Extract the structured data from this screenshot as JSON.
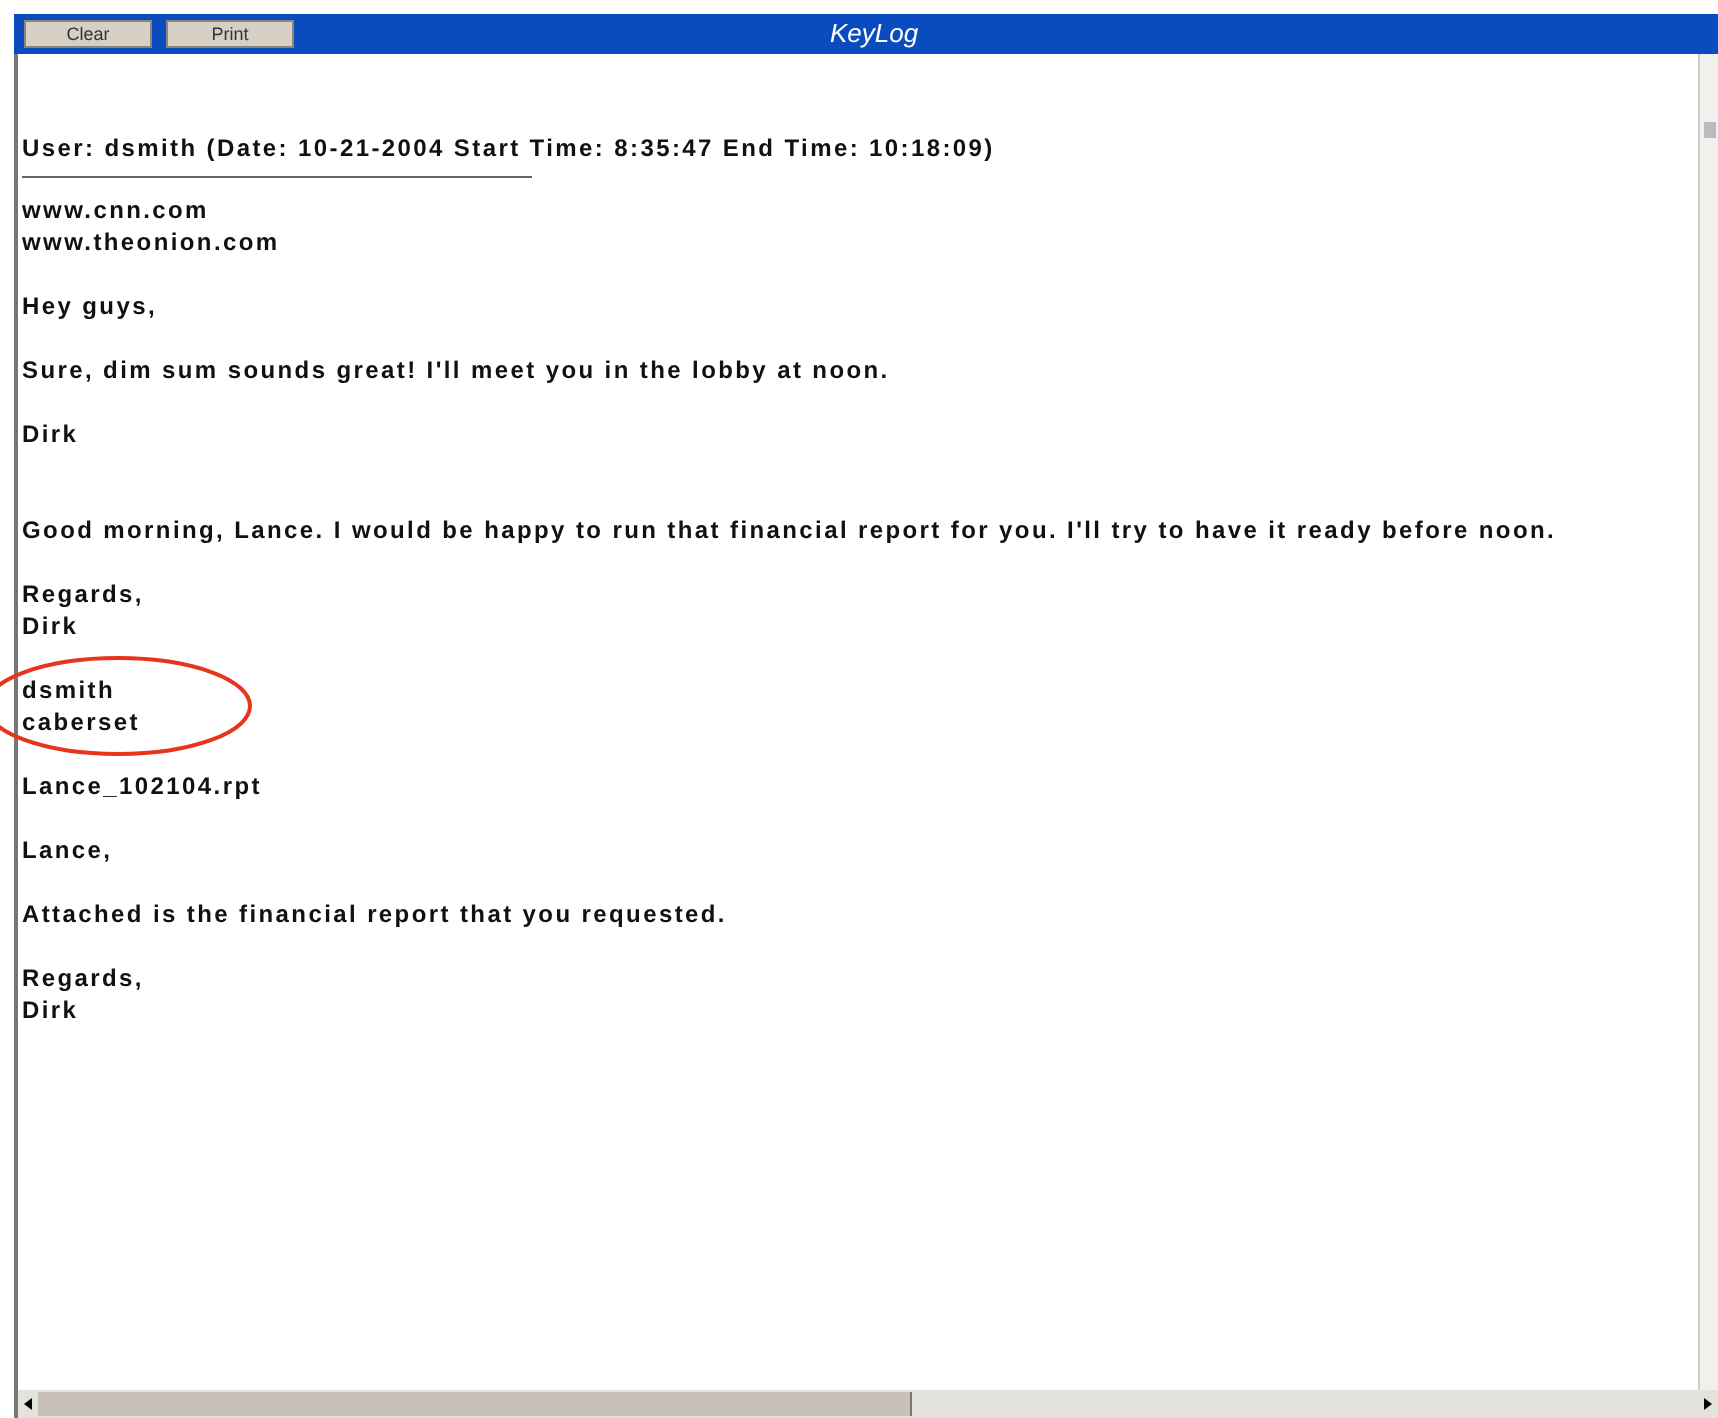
{
  "window": {
    "title": "KeyLog"
  },
  "toolbar": {
    "buttons": [
      "Clear",
      "Print"
    ]
  },
  "log": {
    "header": "User: dsmith  (Date: 10-21-2004  Start Time: 8:35:47  End Time: 10:18:09)",
    "blocks": [
      {
        "lines": [
          "www.cnn.com",
          "www.theonion.com"
        ],
        "break_before": false,
        "highlighted": false
      },
      {
        "lines": [
          "Hey guys,"
        ],
        "break_before": false,
        "highlighted": false
      },
      {
        "lines": [
          "Sure, dim sum sounds great!  I'll meet you in the lobby at noon."
        ],
        "break_before": false,
        "highlighted": false
      },
      {
        "lines": [
          "Dirk"
        ],
        "break_before": false,
        "highlighted": false
      },
      {
        "lines": [
          "Good morning, Lance.  I would be happy to run that financial report for you.  I'll try to have it ready before noon."
        ],
        "break_before": true,
        "highlighted": false
      },
      {
        "lines": [
          "Regards,",
          "Dirk"
        ],
        "break_before": false,
        "highlighted": false
      },
      {
        "lines": [
          "dsmith",
          "caberset"
        ],
        "break_before": false,
        "highlighted": true
      },
      {
        "lines": [
          "Lance_102104.rpt"
        ],
        "break_before": false,
        "highlighted": false
      },
      {
        "lines": [
          "Lance,"
        ],
        "break_before": false,
        "highlighted": false
      },
      {
        "lines": [
          "Attached is the financial report that you requested."
        ],
        "break_before": false,
        "highlighted": false
      },
      {
        "lines": [
          "Regards,",
          "Dirk"
        ],
        "break_before": false,
        "highlighted": false
      }
    ]
  }
}
